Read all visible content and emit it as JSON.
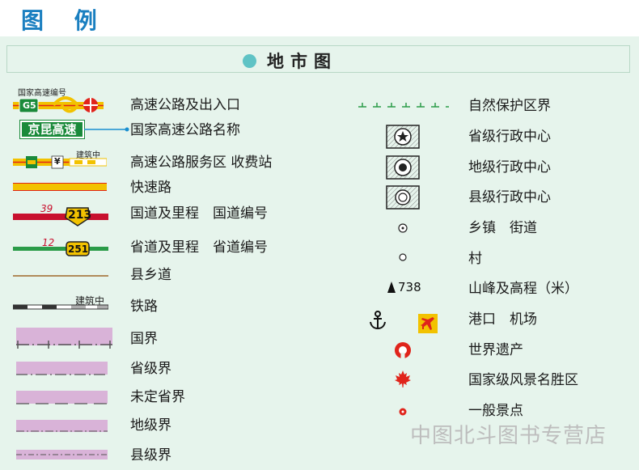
{
  "page": {
    "title": "图 例"
  },
  "section": {
    "title": "地市图"
  },
  "left_items": [
    {
      "name": "expressway-entrance-exit",
      "label": "高速公路及出入口"
    },
    {
      "name": "national-expressway-name",
      "label": "国家高速公路名称"
    },
    {
      "name": "expressway-service-area-toll",
      "label": "高速公路服务区 收费站"
    },
    {
      "name": "fast-road",
      "label": "快速路"
    },
    {
      "name": "national-road",
      "label": "国道及里程　国道编号"
    },
    {
      "name": "provincial-road",
      "label": "省道及里程　省道编号"
    },
    {
      "name": "county-township-road",
      "label": "县乡道"
    },
    {
      "name": "railway",
      "label": "铁路"
    },
    {
      "name": "national-boundary",
      "label": "国界"
    },
    {
      "name": "provincial-boundary",
      "label": "省级界"
    },
    {
      "name": "undetermined-provincial-boundary",
      "label": "未定省界"
    },
    {
      "name": "prefecture-boundary",
      "label": "地级界"
    },
    {
      "name": "county-boundary",
      "label": "县级界"
    }
  ],
  "right_items": [
    {
      "name": "nature-reserve-boundary",
      "label": "自然保护区界"
    },
    {
      "name": "provincial-center",
      "label": "省级行政中心"
    },
    {
      "name": "prefecture-center",
      "label": "地级行政中心"
    },
    {
      "name": "county-center",
      "label": "县级行政中心"
    },
    {
      "name": "township-street",
      "label": "乡镇　街道"
    },
    {
      "name": "village",
      "label": "村"
    },
    {
      "name": "mountain-peak",
      "label": "山峰及高程（米）"
    },
    {
      "name": "port-airport",
      "label": "港口　机场"
    },
    {
      "name": "world-heritage",
      "label": "世界遗产"
    },
    {
      "name": "national-scenic-area",
      "label": "国家级风景名胜区"
    },
    {
      "name": "general-scenic-spot",
      "label": "一般景点"
    }
  ],
  "symbols": {
    "expressway_caption": "国家高速编号",
    "expressway_code": "G5",
    "expressway_name_sign": "京昆高速",
    "under_construction": "建筑中",
    "toll_glyph": "¥",
    "national_road_km": "39",
    "national_road_number": "213",
    "provincial_road_km": "12",
    "provincial_road_number": "251",
    "peak_elevation": "738"
  },
  "watermark": "中图北斗图书专营店",
  "colors": {
    "title": "#1a7fc0",
    "panel": "#e6f4ec",
    "expressway": "#f2c200",
    "expressway_red": "#e0241b",
    "highway_green": "#1a8a3a",
    "national_road_red": "#c8102e",
    "provincial_road_green": "#2a9b48",
    "boundary_purple": "#d9b3d8",
    "county_road": "#b08a5a"
  }
}
